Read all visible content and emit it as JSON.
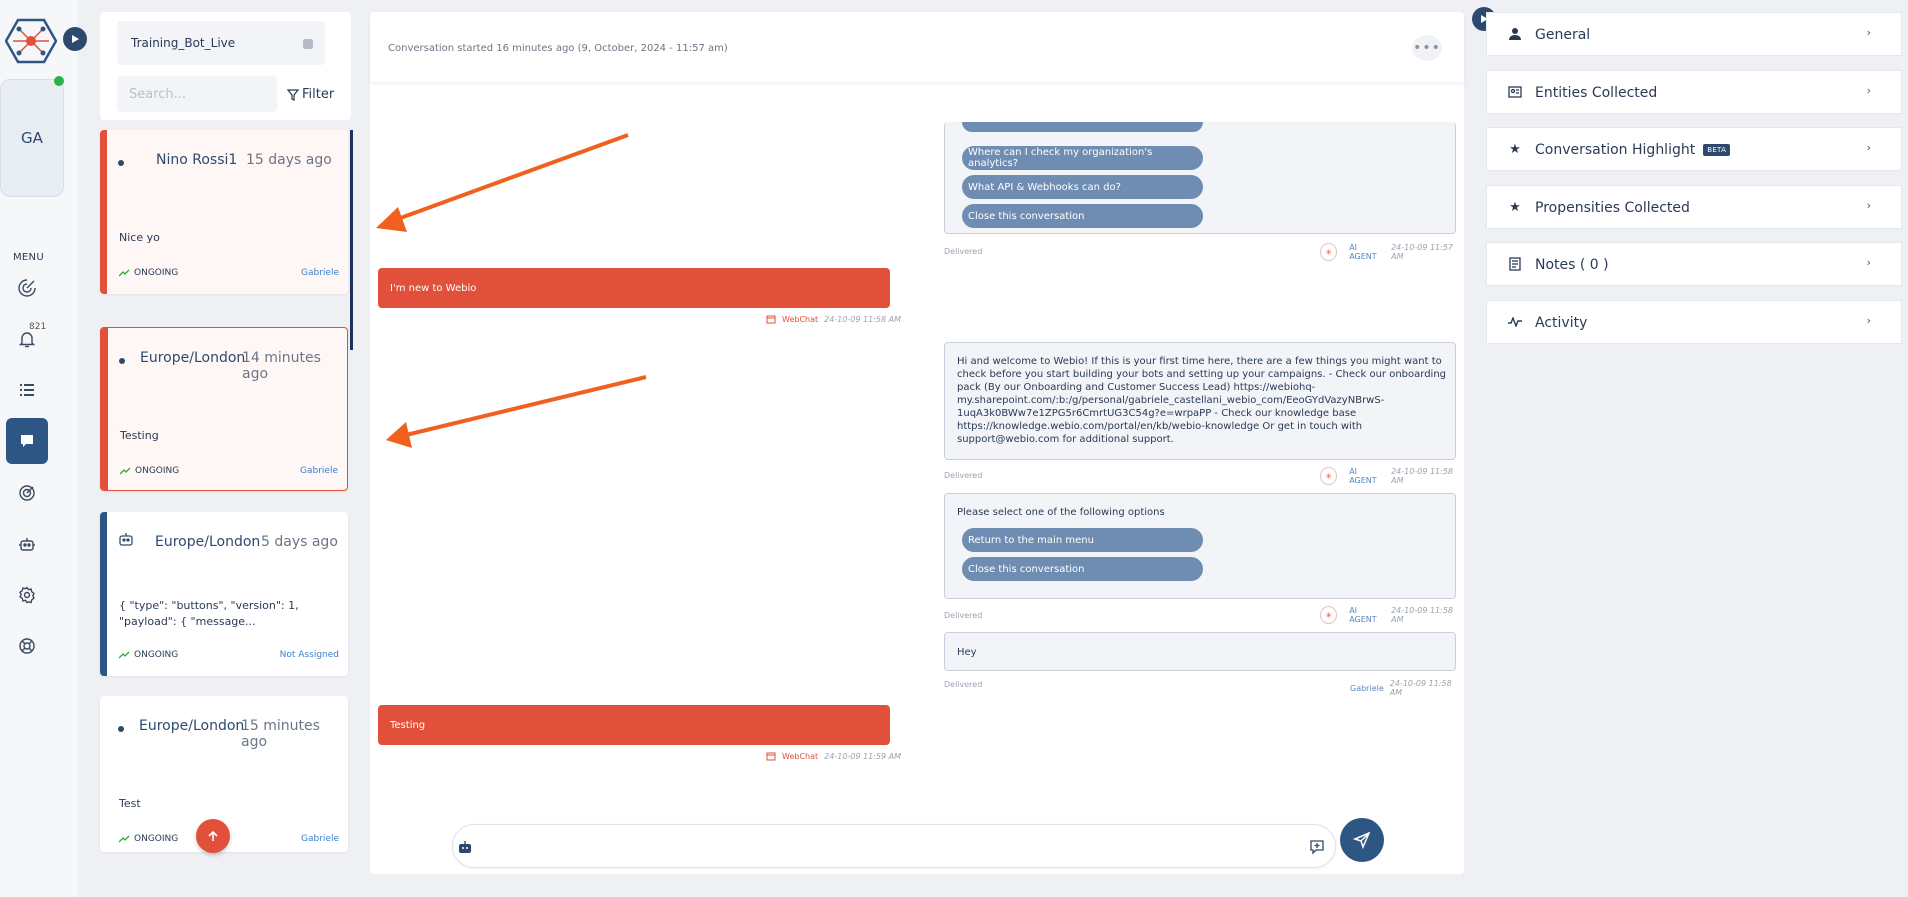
{
  "rail": {
    "avatar_initials": "GA",
    "menu_label": "MENU",
    "notification_count": "821",
    "icons": [
      "analytics-icon",
      "bell-icon",
      "list-icon",
      "chat-icon",
      "target-icon",
      "robot-icon",
      "settings-icon",
      "help-icon"
    ]
  },
  "list_header": {
    "bot_name": "Training_Bot_Live",
    "search_placeholder": "Search...",
    "filter_label": "Filter"
  },
  "conversations": [
    {
      "name": "Nino Rossi1",
      "time": "15 days ago",
      "message": "Nice yo",
      "status": "ONGOING",
      "agent": "Gabriele"
    },
    {
      "name": "Europe/London",
      "time": "14 minutes ago",
      "message": "Testing",
      "status": "ONGOING",
      "agent": "Gabriele"
    },
    {
      "name": "Europe/London",
      "time": "5 days ago",
      "message": "{ \"type\": \"buttons\", \"version\": 1, \"payload\": { \"message...",
      "status": "ONGOING",
      "agent": "Not Assigned"
    },
    {
      "name": "Europe/London",
      "time": "15 minutes ago",
      "message": "Test",
      "status": "ONGOING",
      "agent": "Gabriele"
    }
  ],
  "chat": {
    "started": "Conversation started 16 minutes ago (9, October, 2024 - 11:57 am)",
    "more": "•••",
    "messages": {
      "options1": [
        "Where can I check my organization's analytics?",
        "What API & Webhooks can do?",
        "Close this conversation"
      ],
      "delivered": "Delivered",
      "ai_agent": "AI AGENT",
      "ts_1157": "24-10-09 11:57 AM",
      "ts_1158": "24-10-09 11:58 AM",
      "ts_1159": "24-10-09 11:59 AM",
      "user1": "I'm new to Webio",
      "webchat": "WebChat",
      "welcome": "Hi and welcome to Webio! If this is your first time here, there are a few things you might want to check before you start building your bots and setting up your campaigns. - Check our onboarding pack (By our Onboarding and Customer Success Lead) https://webiohq-my.sharepoint.com/:b:/g/personal/gabriele_castellani_webio_com/EeoGYdVazyNBrwS-1uqA3k0BWw7e1ZPG5r6CmrtUG3C54g?e=wrpaPP - Check our knowledge base https://knowledge.webio.com/portal/en/kb/webio-knowledge Or get in touch with support@webio.com for additional support.",
      "select_prompt": "Please select one of the following options",
      "options2": [
        "Return to the main menu",
        "Close this conversation"
      ],
      "agent_msg": "Hey",
      "agent_name": "Gabriele",
      "user2": "Testing"
    }
  },
  "details": {
    "sections": [
      {
        "title": "General",
        "icon": "user-icon"
      },
      {
        "title": "Entities Collected",
        "icon": "id-card-icon"
      },
      {
        "title": "Conversation Highlight",
        "icon": "star-icon",
        "badge": "BETA"
      },
      {
        "title": "Propensities Collected",
        "icon": "star-icon"
      },
      {
        "title": "Notes ( 0 )",
        "icon": "note-icon"
      },
      {
        "title": "Activity",
        "icon": "activity-icon"
      }
    ]
  },
  "colors": {
    "brand_orange": "#e0503a",
    "navy": "#2d4a6e",
    "option_blue": "#6f8db3"
  }
}
